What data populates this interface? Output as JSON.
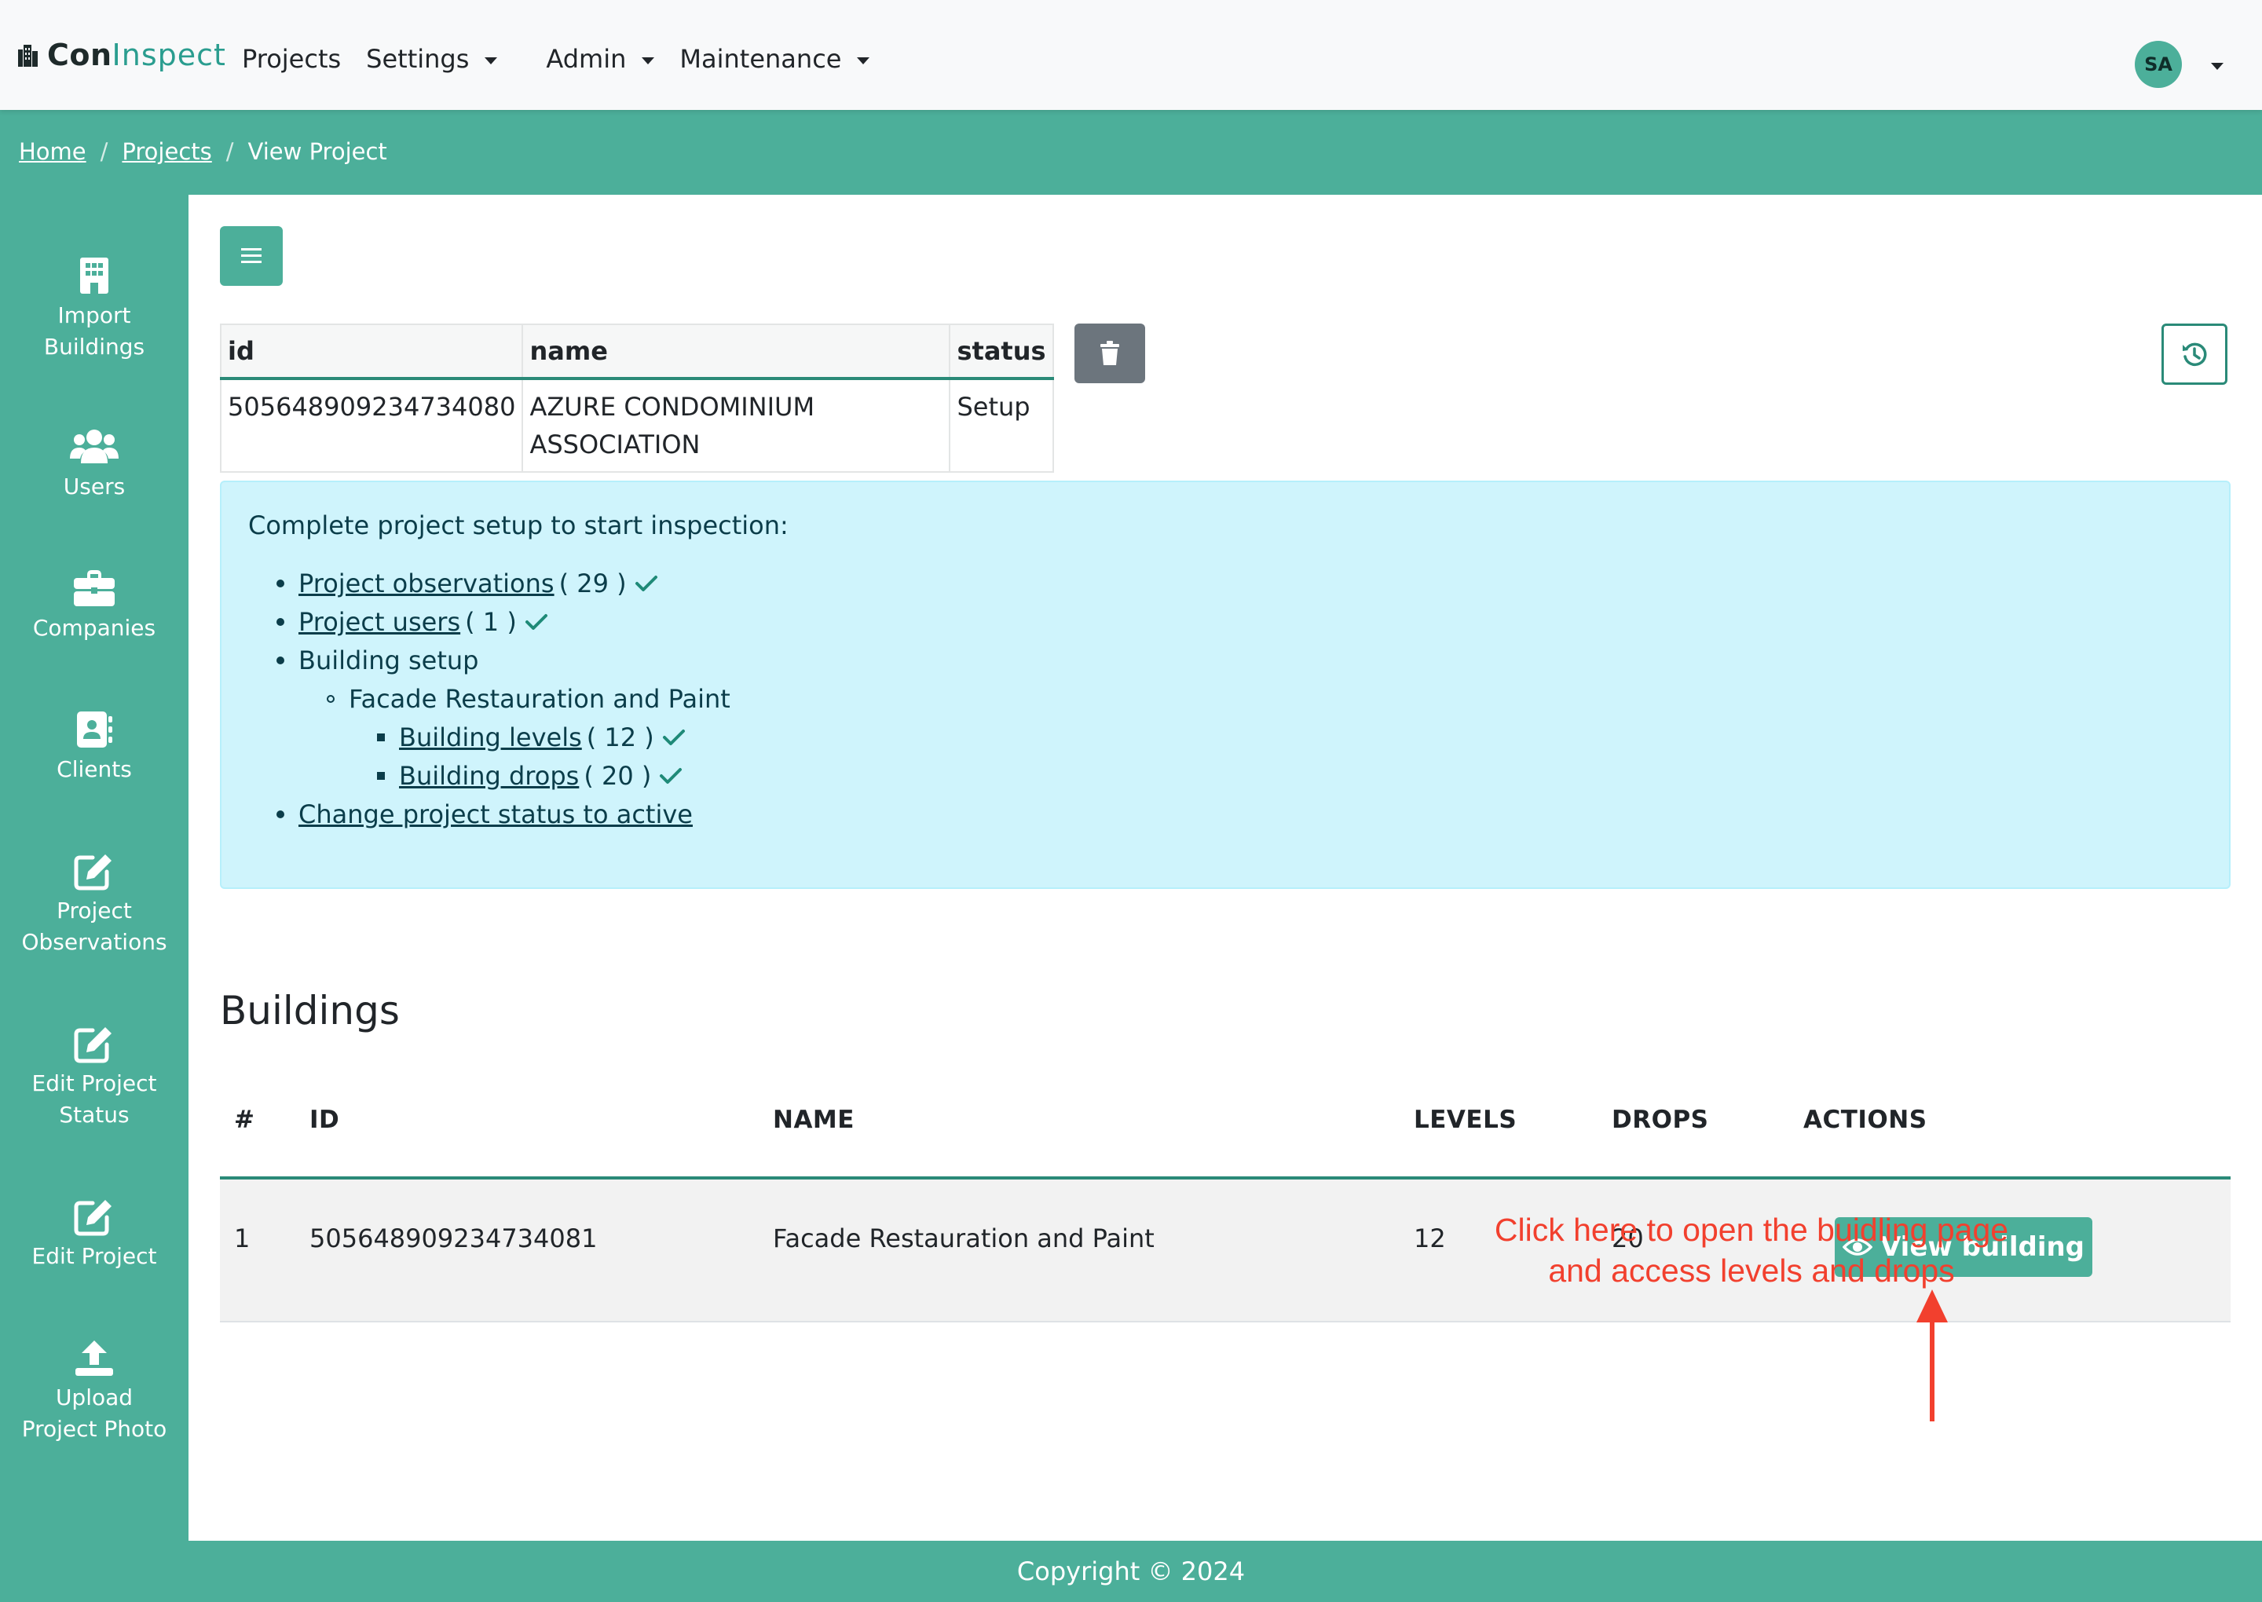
{
  "navbar": {
    "brand_con": "Con",
    "brand_inspect": "Inspect",
    "menu": [
      {
        "label": "Projects"
      },
      {
        "label": "Settings"
      },
      {
        "label": "Admin"
      },
      {
        "label": "Maintenance"
      }
    ],
    "avatar_initials": "SA"
  },
  "breadcrumb": {
    "home": "Home",
    "projects": "Projects",
    "current": "View Project",
    "separator": "/"
  },
  "sidebar": {
    "items": [
      {
        "label": "Import Buildings",
        "icon": "building-icon"
      },
      {
        "label": "Users",
        "icon": "users-icon"
      },
      {
        "label": "Companies",
        "icon": "briefcase-icon"
      },
      {
        "label": "Clients",
        "icon": "contact-book-icon"
      },
      {
        "label": "Project Observations",
        "icon": "edit-icon"
      },
      {
        "label": "Edit Project Status",
        "icon": "edit-icon"
      },
      {
        "label": "Edit Project",
        "icon": "edit-icon"
      },
      {
        "label": "Upload Project Photo",
        "icon": "upload-icon"
      }
    ]
  },
  "project_table": {
    "headers": [
      "id",
      "name",
      "status"
    ],
    "row": {
      "id": "505648909234734080",
      "name_line1": "AZURE CONDOMINIUM",
      "name_line2": "ASSOCIATION",
      "status": "Setup"
    }
  },
  "setup_alert": {
    "title": "Complete project setup to start inspection:",
    "observations_link": "Project observations ",
    "observations_count": "( 29 )",
    "users_link": "Project users ",
    "users_count": "( 1 )",
    "building_setup": "Building setup",
    "building_name": "Facade Restauration and Paint",
    "levels_link": "Building levels ",
    "levels_count": "( 12 )",
    "drops_link": "Building drops ",
    "drops_count": "( 20 )",
    "status_link": "Change project status to active"
  },
  "buildings": {
    "heading": "Buildings",
    "headers": [
      "#",
      "ID",
      "NAME",
      "LEVELS",
      "DROPS",
      "ACTIONS"
    ],
    "rows": [
      {
        "num": "1",
        "id": "505648909234734081",
        "name": "Facade Restauration and Paint",
        "levels": "12",
        "drops": "20",
        "action": "View building"
      }
    ]
  },
  "annotation": {
    "line1": "Click here to open the buidling page",
    "line2": "and access levels and drops",
    "color": "#f2402e"
  },
  "footer": {
    "copyright": "Copyright © 2024"
  },
  "colors": {
    "primary": "#4caf9a",
    "dark_teal": "#2a8a78",
    "alert_bg": "#cff4fc",
    "delete_gray": "#6c757d"
  }
}
